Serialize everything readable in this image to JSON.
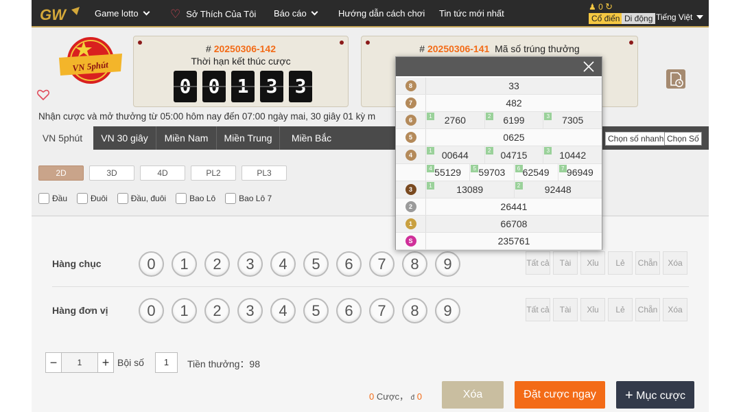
{
  "nav": {
    "items": [
      {
        "label": "Game lotto",
        "has_chevron": true
      },
      {
        "label": "Sở Thích Của Tôi",
        "icon": "heart-icon"
      },
      {
        "label": "Báo cáo",
        "has_chevron": true
      },
      {
        "label": "Hướng dẫn cách chơi"
      },
      {
        "label": "Tin tức mới nhất"
      }
    ],
    "balance": "0",
    "mode_classic": "Cổ điển",
    "mode_mobile": "Di động",
    "language": "Tiếng Việt"
  },
  "header": {
    "badge_text": "VN 5phút",
    "current_issue_prefix": "#",
    "current_issue": "20250306-142",
    "countdown_label": "Thời hạn kết thúc cược",
    "countdown_digits": [
      "0",
      "0",
      "1",
      "3",
      "3"
    ],
    "result_issue_prefix": "#",
    "result_issue": "20250306-141",
    "result_label": "Mã số trúng thưởng",
    "notice": "Nhận cược và mở thưởng từ 05:00 hôm nay đến 07:00 ngày mai,    30 giây 01 kỳ m"
  },
  "tabs": [
    "VN 5phút",
    "VN 30 giây",
    "Miền Nam",
    "Miền Trung",
    "Miền Bắc"
  ],
  "quick_pick": {
    "fast": "Chọn số nhanh",
    "pick": "Chọn Số"
  },
  "subtabs": [
    "2D",
    "3D",
    "4D",
    "PL2",
    "PL3"
  ],
  "options": [
    "Đầu",
    "Đuôi",
    "Đầu, đuôi",
    "Bao Lô",
    "Bao Lô 7"
  ],
  "rows": [
    {
      "label": "Hàng chục",
      "balls": [
        "0",
        "1",
        "2",
        "3",
        "4",
        "5",
        "6",
        "7",
        "8",
        "9"
      ]
    },
    {
      "label": "Hàng đơn vị",
      "balls": [
        "0",
        "1",
        "2",
        "3",
        "4",
        "5",
        "6",
        "7",
        "8",
        "9"
      ]
    }
  ],
  "quick_buttons": [
    "Tất cả",
    "Tài",
    "Xỉu",
    "Lẻ",
    "Chẵn",
    "Xóa"
  ],
  "multiplier": {
    "minus": "−",
    "value": "1",
    "plus": "+",
    "label": "Bội số"
  },
  "prize": {
    "box_value": "1",
    "label": "Tiền thưởng：98"
  },
  "summary": {
    "count": "0",
    "count_label": "Cược，",
    "currency": "đ",
    "amount": "0"
  },
  "buttons": {
    "clear": "Xóa",
    "bet": "Đặt cược ngay",
    "list": "Mục cược"
  },
  "results": [
    {
      "medal": "8",
      "color": "#b48a5a",
      "cells": [
        {
          "v": "33"
        }
      ]
    },
    {
      "medal": "7",
      "color": "#b48a5a",
      "cells": [
        {
          "v": "482"
        }
      ]
    },
    {
      "medal": "6",
      "color": "#b48a5a",
      "cells": [
        {
          "t": "1",
          "v": "2760"
        },
        {
          "t": "2",
          "v": "6199"
        },
        {
          "t": "3",
          "v": "7305"
        }
      ]
    },
    {
      "medal": "5",
      "color": "#b48a5a",
      "cells": [
        {
          "v": "0625"
        }
      ]
    },
    {
      "medal": "4",
      "color": "#b48a5a",
      "cells": [
        {
          "t": "1",
          "v": "00644"
        },
        {
          "t": "2",
          "v": "04715"
        },
        {
          "t": "3",
          "v": "10442"
        }
      ]
    },
    {
      "medal": "",
      "color": "",
      "cells": [
        {
          "t": "4",
          "v": "55129"
        },
        {
          "t": "5",
          "v": "59703"
        },
        {
          "t": "6",
          "v": "62549"
        },
        {
          "t": "7",
          "v": "96949"
        }
      ]
    },
    {
      "medal": "3",
      "color": "#7a4a20",
      "cells": [
        {
          "t": "1",
          "v": "13089"
        },
        {
          "t": "2",
          "v": "92448"
        }
      ]
    },
    {
      "medal": "2",
      "color": "#9a9a9a",
      "cells": [
        {
          "v": "26441"
        }
      ]
    },
    {
      "medal": "1",
      "color": "#c9a040",
      "cells": [
        {
          "v": "66708"
        }
      ]
    },
    {
      "medal": "S",
      "color": "#d0309a",
      "cells": [
        {
          "v": "235761"
        }
      ]
    }
  ]
}
